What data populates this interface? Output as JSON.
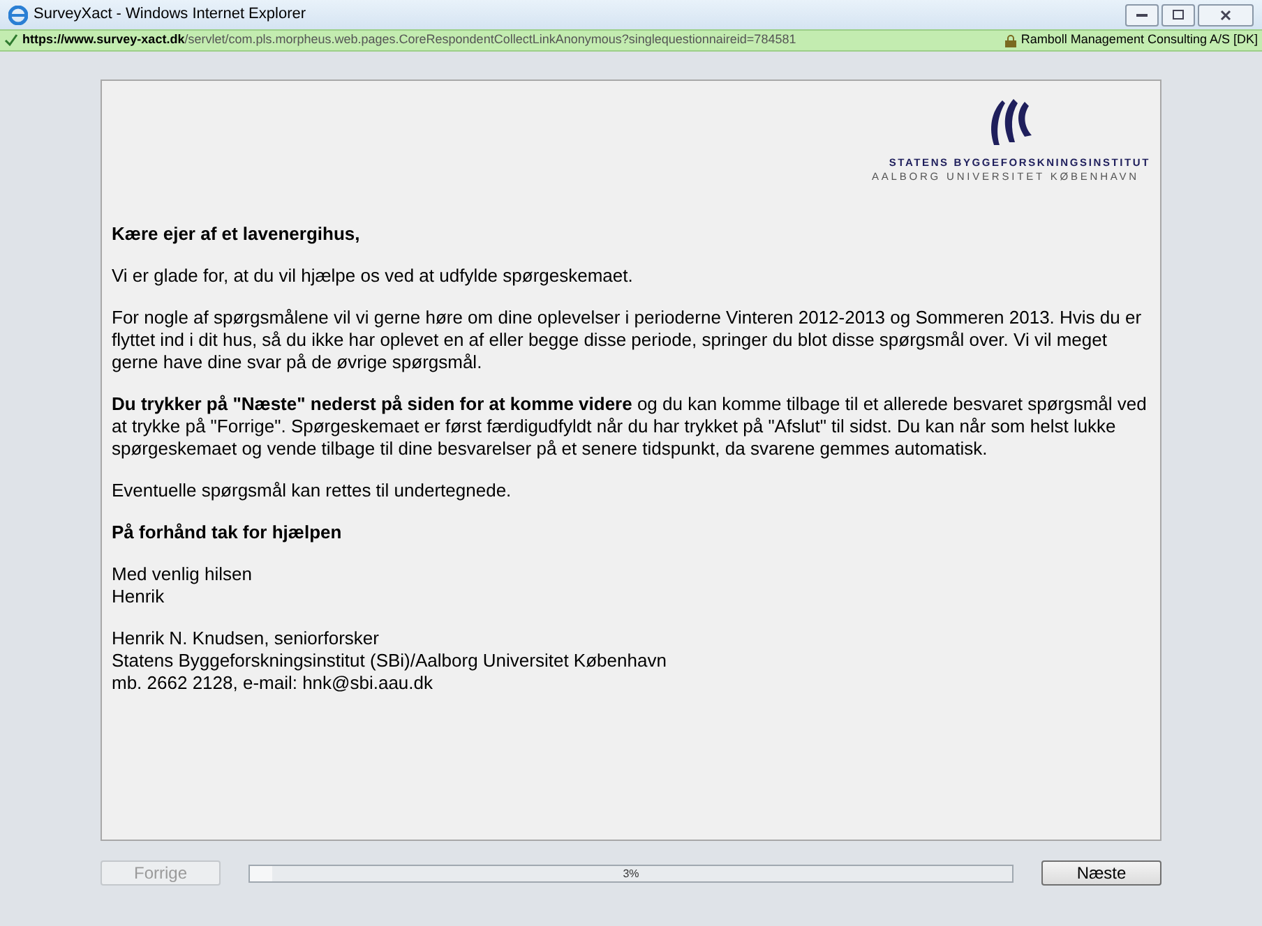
{
  "window": {
    "title": "SurveyXact - Windows Internet Explorer"
  },
  "address_bar": {
    "url_domain": "https://www.survey-xact.dk",
    "url_path": "/servlet/com.pls.morpheus.web.pages.CoreRespondentCollectLinkAnonymous?singlequestionnaireid=784581",
    "certificate": "Ramboll Management Consulting A/S [DK]"
  },
  "logo": {
    "line_1": "STATENS BYGGEFORSKNINGSINSTITUT",
    "line_2": "AALBORG UNIVERSITET KØBENHAVN"
  },
  "letter": [
    {
      "kind": "heading",
      "text": "Kære ejer af et lavenergihus,"
    },
    {
      "kind": "paragraph",
      "text": "Vi er glade for, at du vil hjælpe os ved at udfylde spørgeskemaet."
    },
    {
      "kind": "paragraph",
      "text": "For nogle af spørgsmålene vil vi gerne høre om dine oplevelser i perioderne Vinteren 2012-2013 og Sommeren 2013. Hvis du er flyttet ind i dit hus, så du ikke har oplevet en af eller begge disse periode, springer du blot disse spørgsmål over. Vi vil meget gerne have dine svar på de øvrige spørgsmål."
    },
    {
      "kind": "paragraph",
      "text": "**Du trykker på \"Næste\" nederst på siden for at komme videre** og du kan komme tilbage til et allerede besvaret spørgsmål ved at trykke på \"Forrige\". Spørgeskemaet er først færdigudfyldt når du har trykket på \"Afslut\" til sidst. Du kan når som helst lukke spørgeskemaet og vende tilbage til dine besvarelser på et senere tidspunkt, da svarene gemmes automatisk."
    },
    {
      "kind": "paragraph",
      "text": "Eventuelle spørgsmål kan rettes til undertegnede."
    },
    {
      "kind": "heading",
      "text": "På forhånd tak for hjælpen"
    },
    {
      "kind": "lines",
      "lines": [
        "Med venlig hilsen",
        "Henrik"
      ]
    },
    {
      "kind": "lines",
      "lines": [
        "Henrik N. Knudsen, seniorforsker",
        "Statens Byggeforskningsinstitut (SBi)/Aalborg Universitet København",
        "mb. 2662 2128, e-mail: hnk@sbi.aau.dk"
      ]
    }
  ],
  "navigation": {
    "previous": {
      "label": "Forrige",
      "disabled": true
    },
    "progress": {
      "level": 0.03,
      "reading": "3%"
    },
    "next": {
      "label": "Næste",
      "disabled": false
    }
  }
}
